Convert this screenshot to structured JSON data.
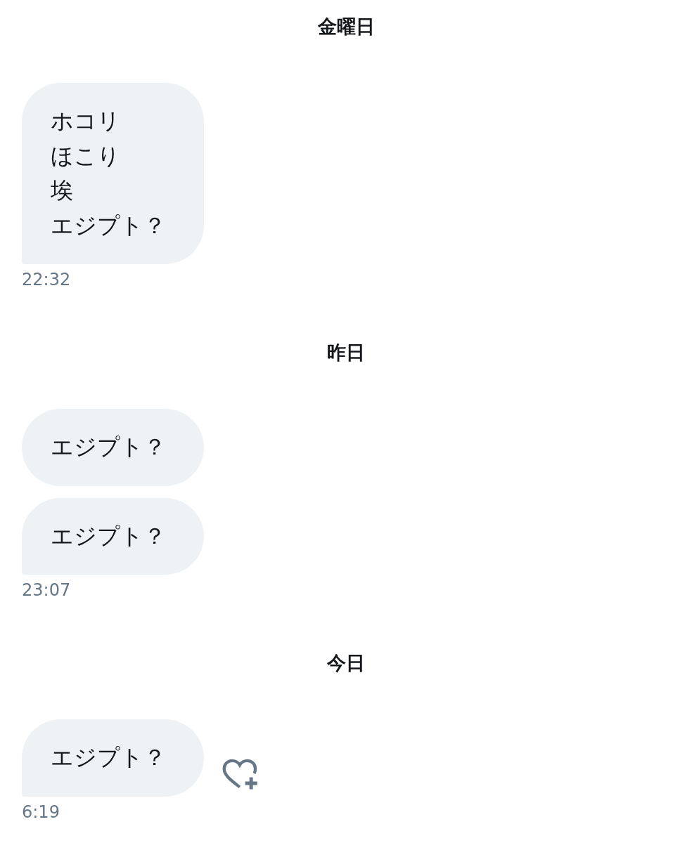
{
  "conversation": {
    "days": [
      {
        "date_label": "金曜日",
        "messages": [
          {
            "lines": [
              "ホコリ",
              "ほこり",
              "埃",
              "エジプト？"
            ],
            "like_button": false
          }
        ],
        "time": "22:32"
      },
      {
        "date_label": "昨日",
        "messages": [
          {
            "lines": [
              "エジプト？"
            ],
            "like_button": false
          },
          {
            "lines": [
              "エジプト？"
            ],
            "like_button": false
          }
        ],
        "time": "23:07"
      },
      {
        "date_label": "今日",
        "messages": [
          {
            "lines": [
              "エジプト？"
            ],
            "like_button": true
          }
        ],
        "time": "6:19"
      }
    ]
  }
}
